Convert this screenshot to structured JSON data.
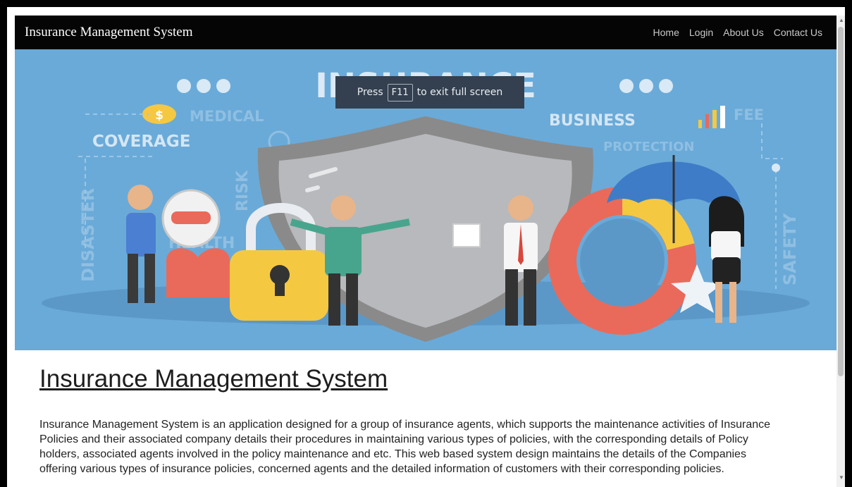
{
  "navbar": {
    "brand": "Insurance Management System",
    "links": [
      "Home",
      "Login",
      "About Us",
      "Contact Us"
    ]
  },
  "fullscreen_notice": {
    "prefix": "Press",
    "key": "F11",
    "suffix": "to exit full screen"
  },
  "hero": {
    "title": "INSURANCE",
    "words": [
      "MEDICAL",
      "COVERAGE",
      "BUSINESS",
      "FEE",
      "PROTECTION",
      "DISASTER",
      "RISK",
      "HEALTH",
      "SAFETY"
    ],
    "background": "#6aaad8"
  },
  "main": {
    "heading": "Insurance Management System",
    "description": "Insurance Management System is an application designed for a group of insurance agents, which supports the maintenance activities of Insurance Policies and their associated company details their procedures in maintaining various types of policies, with the corresponding details of Policy holders, associated agents involved in the policy maintenance and etc. This web based system design maintains the details of the Companies offering various types of insurance policies, concerned agents and the detailed information of customers with their corresponding policies."
  },
  "scrollbar": {
    "up_icon": "triangle-up",
    "down_icon": "triangle-down"
  }
}
